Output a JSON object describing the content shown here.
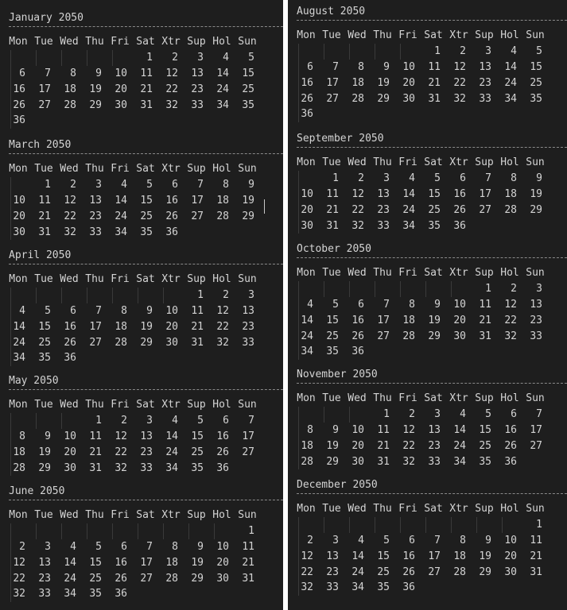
{
  "weekday_labels": [
    "Mon",
    "Tue",
    "Wed",
    "Thu",
    "Fri",
    "Sat",
    "Xtr",
    "Sup",
    "Hol",
    "Sun"
  ],
  "separator_text": "-----------------------------------------------",
  "panes": [
    {
      "id": "left",
      "months": [
        {
          "title": "January 2050",
          "weeks": [
            [
              "",
              "",
              "",
              "",
              "",
              "1",
              "2",
              "3",
              "4",
              "5"
            ],
            [
              "6",
              "7",
              "8",
              "9",
              "10",
              "11",
              "12",
              "13",
              "14",
              "15"
            ],
            [
              "16",
              "17",
              "18",
              "19",
              "20",
              "21",
              "22",
              "23",
              "24",
              "25"
            ],
            [
              "26",
              "27",
              "28",
              "29",
              "30",
              "31",
              "32",
              "33",
              "34",
              "35"
            ],
            [
              "36"
            ]
          ]
        },
        {
          "title": "March 2050",
          "weeks": [
            [
              "",
              "1",
              "2",
              "3",
              "4",
              "5",
              "6",
              "7",
              "8",
              "9"
            ],
            [
              "10",
              "11",
              "12",
              "13",
              "14",
              "15",
              "16",
              "17",
              "18",
              "19"
            ],
            [
              "20",
              "21",
              "22",
              "23",
              "24",
              "25",
              "26",
              "27",
              "28",
              "29"
            ],
            [
              "30",
              "31",
              "32",
              "33",
              "34",
              "35",
              "36"
            ]
          ]
        },
        {
          "title": "April 2050",
          "weeks": [
            [
              "",
              "",
              "",
              "",
              "",
              "",
              "",
              "1",
              "2",
              "3"
            ],
            [
              "4",
              "5",
              "6",
              "7",
              "8",
              "9",
              "10",
              "11",
              "12",
              "13"
            ],
            [
              "14",
              "15",
              "16",
              "17",
              "18",
              "19",
              "20",
              "21",
              "22",
              "23"
            ],
            [
              "24",
              "25",
              "26",
              "27",
              "28",
              "29",
              "30",
              "31",
              "32",
              "33"
            ],
            [
              "34",
              "35",
              "36"
            ]
          ]
        },
        {
          "title": "May 2050",
          "weeks": [
            [
              "",
              "",
              "",
              "1",
              "2",
              "3",
              "4",
              "5",
              "6",
              "7"
            ],
            [
              "8",
              "9",
              "10",
              "11",
              "12",
              "13",
              "14",
              "15",
              "16",
              "17"
            ],
            [
              "18",
              "19",
              "20",
              "21",
              "22",
              "23",
              "24",
              "25",
              "26",
              "27"
            ],
            [
              "28",
              "29",
              "30",
              "31",
              "32",
              "33",
              "34",
              "35",
              "36"
            ]
          ]
        },
        {
          "title": "June 2050",
          "weeks": [
            [
              "",
              "",
              "",
              "",
              "",
              "",
              "",
              "",
              "",
              "1"
            ],
            [
              "2",
              "3",
              "4",
              "5",
              "6",
              "7",
              "8",
              "9",
              "10",
              "11"
            ],
            [
              "12",
              "13",
              "14",
              "15",
              "16",
              "17",
              "18",
              "19",
              "20",
              "21"
            ],
            [
              "22",
              "23",
              "24",
              "25",
              "26",
              "27",
              "28",
              "29",
              "30",
              "31"
            ],
            [
              "32",
              "33",
              "34",
              "35",
              "36"
            ]
          ]
        }
      ]
    },
    {
      "id": "right",
      "months": [
        {
          "title": "August 2050",
          "weeks": [
            [
              "",
              "",
              "",
              "",
              "",
              "1",
              "2",
              "3",
              "4",
              "5"
            ],
            [
              "6",
              "7",
              "8",
              "9",
              "10",
              "11",
              "12",
              "13",
              "14",
              "15"
            ],
            [
              "16",
              "17",
              "18",
              "19",
              "20",
              "21",
              "22",
              "23",
              "24",
              "25"
            ],
            [
              "26",
              "27",
              "28",
              "29",
              "30",
              "31",
              "32",
              "33",
              "34",
              "35"
            ],
            [
              "36"
            ]
          ]
        },
        {
          "title": "September 2050",
          "weeks": [
            [
              "",
              "1",
              "2",
              "3",
              "4",
              "5",
              "6",
              "7",
              "8",
              "9"
            ],
            [
              "10",
              "11",
              "12",
              "13",
              "14",
              "15",
              "16",
              "17",
              "18",
              "19"
            ],
            [
              "20",
              "21",
              "22",
              "23",
              "24",
              "25",
              "26",
              "27",
              "28",
              "29"
            ],
            [
              "30",
              "31",
              "32",
              "33",
              "34",
              "35",
              "36"
            ]
          ]
        },
        {
          "title": "October 2050",
          "weeks": [
            [
              "",
              "",
              "",
              "",
              "",
              "",
              "",
              "1",
              "2",
              "3"
            ],
            [
              "4",
              "5",
              "6",
              "7",
              "8",
              "9",
              "10",
              "11",
              "12",
              "13"
            ],
            [
              "14",
              "15",
              "16",
              "17",
              "18",
              "19",
              "20",
              "21",
              "22",
              "23"
            ],
            [
              "24",
              "25",
              "26",
              "27",
              "28",
              "29",
              "30",
              "31",
              "32",
              "33"
            ],
            [
              "34",
              "35",
              "36"
            ]
          ]
        },
        {
          "title": "November 2050",
          "weeks": [
            [
              "",
              "",
              "",
              "1",
              "2",
              "3",
              "4",
              "5",
              "6",
              "7"
            ],
            [
              "8",
              "9",
              "10",
              "11",
              "12",
              "13",
              "14",
              "15",
              "16",
              "17"
            ],
            [
              "18",
              "19",
              "20",
              "21",
              "22",
              "23",
              "24",
              "25",
              "26",
              "27"
            ],
            [
              "28",
              "29",
              "30",
              "31",
              "32",
              "33",
              "34",
              "35",
              "36"
            ]
          ]
        },
        {
          "title": "December 2050",
          "weeks": [
            [
              "",
              "",
              "",
              "",
              "",
              "",
              "",
              "",
              "",
              "1"
            ],
            [
              "2",
              "3",
              "4",
              "5",
              "6",
              "7",
              "8",
              "9",
              "10",
              "11"
            ],
            [
              "12",
              "13",
              "14",
              "15",
              "16",
              "17",
              "18",
              "19",
              "20",
              "21"
            ],
            [
              "22",
              "23",
              "24",
              "25",
              "26",
              "27",
              "28",
              "29",
              "30",
              "31"
            ],
            [
              "32",
              "33",
              "34",
              "35",
              "36"
            ]
          ]
        }
      ]
    }
  ],
  "colors": {
    "background": "#1e1e1e",
    "text": "#d4d4d4",
    "separator": "#8a8a8a",
    "indent_guide": "#3a3a3a",
    "cursor": "#c8c8c8",
    "gutter": "#ffffff"
  }
}
